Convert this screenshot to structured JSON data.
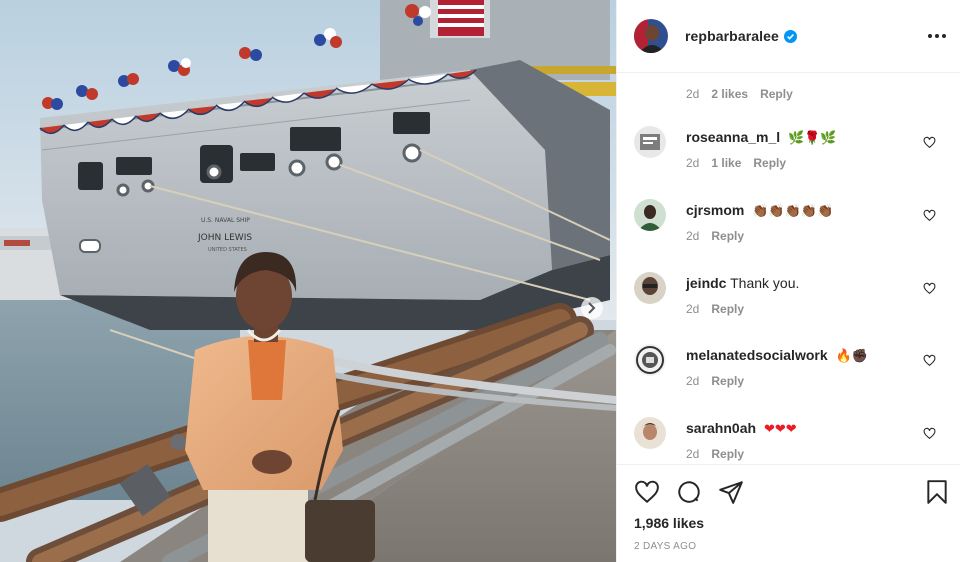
{
  "post": {
    "username": "repbarbaralee",
    "verified": true,
    "photo_lettering": {
      "ship_line1": "U.S. NAVAL SHIP",
      "ship_name": "JOHN LEWIS",
      "ship_line3": "UNITED STATES"
    }
  },
  "top_meta": {
    "time": "2d",
    "likes": "2 likes",
    "reply": "Reply"
  },
  "comments": [
    {
      "user": "roseanna_m_l",
      "text": "",
      "emoji": "🌿🌹🌿",
      "time": "2d",
      "likes": "1 like",
      "reply": "Reply",
      "avatar_color": "#7d7d7d"
    },
    {
      "user": "cjrsmom",
      "text": "",
      "emoji": "👏🏾👏🏾👏🏾👏🏾👏🏾",
      "time": "2d",
      "likes": "",
      "reply": "Reply",
      "avatar_color": "#2f5d3a"
    },
    {
      "user": "jeindc",
      "text": "Thank you.",
      "emoji": "",
      "time": "2d",
      "likes": "",
      "reply": "Reply",
      "avatar_color": "#5a4438"
    },
    {
      "user": "melanatedsocialwork",
      "text": "",
      "emoji": "🔥✊🏿",
      "time": "2d",
      "likes": "",
      "reply": "Reply",
      "avatar_color": "#333333"
    },
    {
      "user": "sarahn0ah",
      "text": "",
      "emoji": "❤❤❤",
      "time": "2d",
      "likes": "",
      "reply": "Reply",
      "avatar_color": "#b9866a"
    }
  ],
  "footer": {
    "likes": "1,986 likes",
    "time": "2 DAYS AGO"
  },
  "colors": {
    "accent": "#0095f6",
    "meta": "#8e8e8e",
    "text": "#262626",
    "heart_emoji": "#ed1c24"
  },
  "icons": [
    "more-icon",
    "heart-icon",
    "comment-icon",
    "share-icon",
    "save-icon",
    "verified-icon"
  ]
}
